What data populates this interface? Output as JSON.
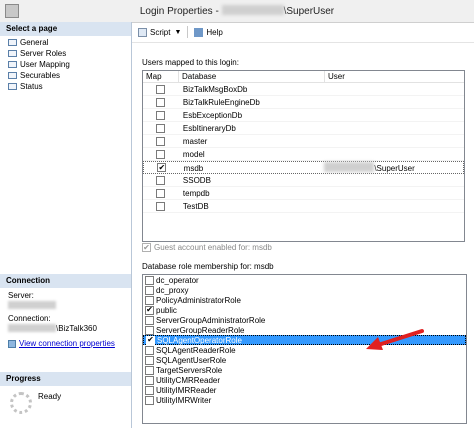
{
  "window": {
    "title_prefix": "Login Properties - ",
    "title_suffix": "\\SuperUser"
  },
  "left": {
    "select_page_header": "Select a page",
    "pages": [
      "General",
      "Server Roles",
      "User Mapping",
      "Securables",
      "Status"
    ],
    "connection_header": "Connection",
    "server_label": "Server:",
    "connection_label": "Connection:",
    "connection_suffix": "\\BizTalk360",
    "view_link": "View connection properties",
    "progress_header": "Progress",
    "progress_status": "Ready"
  },
  "toolbar": {
    "script_label": "Script",
    "help_label": "Help"
  },
  "mapping": {
    "label": "Users mapped to this login:",
    "columns": [
      "Map",
      "Database",
      "User"
    ],
    "rows": [
      {
        "db": "BizTalkMsgBoxDb",
        "checked": false,
        "user": ""
      },
      {
        "db": "BizTalkRuleEngineDb",
        "checked": false,
        "user": ""
      },
      {
        "db": "EsbExceptionDb",
        "checked": false,
        "user": ""
      },
      {
        "db": "EsbItineraryDb",
        "checked": false,
        "user": ""
      },
      {
        "db": "master",
        "checked": false,
        "user": ""
      },
      {
        "db": "model",
        "checked": false,
        "user": ""
      },
      {
        "db": "msdb",
        "checked": true,
        "user": "\\SuperUser"
      },
      {
        "db": "SSODB",
        "checked": false,
        "user": ""
      },
      {
        "db": "tempdb",
        "checked": false,
        "user": ""
      },
      {
        "db": "TestDB",
        "checked": false,
        "user": ""
      }
    ]
  },
  "guest": {
    "label": "Guest account enabled for: msdb",
    "checked": true
  },
  "roles": {
    "label": "Database role membership for: msdb",
    "items": [
      {
        "name": "dc_operator",
        "checked": false
      },
      {
        "name": "dc_proxy",
        "checked": false
      },
      {
        "name": "PolicyAdministratorRole",
        "checked": false
      },
      {
        "name": "public",
        "checked": true
      },
      {
        "name": "ServerGroupAdministratorRole",
        "checked": false
      },
      {
        "name": "ServerGroupReaderRole",
        "checked": false
      },
      {
        "name": "SQLAgentOperatorRole",
        "checked": true
      },
      {
        "name": "SQLAgentReaderRole",
        "checked": false
      },
      {
        "name": "SQLAgentUserRole",
        "checked": false
      },
      {
        "name": "TargetServersRole",
        "checked": false
      },
      {
        "name": "UtilityCMRReader",
        "checked": false
      },
      {
        "name": "UtilityIMRReader",
        "checked": false
      },
      {
        "name": "UtilityIMRWriter",
        "checked": false
      }
    ],
    "selected_index": 6
  },
  "colors": {
    "selection": "#3399ff",
    "arrow": "#e02020",
    "header_bg": "#d9e4f1",
    "link": "#0000d0"
  }
}
